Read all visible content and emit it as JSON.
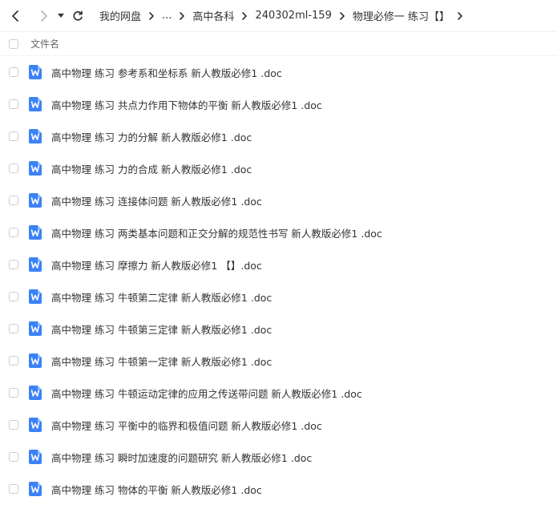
{
  "toolbar": {
    "back_icon": "back-arrow-icon",
    "forward_icon": "forward-arrow-icon",
    "history_icon": "dropdown-caret-icon",
    "refresh_icon": "refresh-icon"
  },
  "breadcrumb": {
    "items": [
      "我的网盘",
      "...",
      "高中各科",
      "240302ml-159",
      "物理必修一 练习【】"
    ]
  },
  "list_header": {
    "column_name": "文件名"
  },
  "colors": {
    "doc_icon": "#3b82f6",
    "text": "#333333"
  },
  "files": [
    {
      "name": "高中物理 练习 参考系和坐标系 新人教版必修1 .doc"
    },
    {
      "name": "高中物理 练习 共点力作用下物体的平衡 新人教版必修1 .doc"
    },
    {
      "name": "高中物理 练习 力的分解 新人教版必修1 .doc"
    },
    {
      "name": "高中物理 练习 力的合成 新人教版必修1 .doc"
    },
    {
      "name": "高中物理 练习 连接体问题 新人教版必修1 .doc"
    },
    {
      "name": "高中物理 练习 两类基本问题和正交分解的规范性书写 新人教版必修1 .doc"
    },
    {
      "name": "高中物理 练习 摩擦力 新人教版必修1 【】.doc"
    },
    {
      "name": "高中物理 练习 牛顿第二定律 新人教版必修1 .doc"
    },
    {
      "name": "高中物理 练习 牛顿第三定律 新人教版必修1 .doc"
    },
    {
      "name": "高中物理 练习 牛顿第一定律 新人教版必修1 .doc"
    },
    {
      "name": "高中物理 练习 牛顿运动定律的应用之传送带问题 新人教版必修1 .doc"
    },
    {
      "name": "高中物理 练习 平衡中的临界和极值问题 新人教版必修1 .doc"
    },
    {
      "name": "高中物理 练习 瞬时加速度的问题研究 新人教版必修1 .doc"
    },
    {
      "name": "高中物理 练习 物体的平衡 新人教版必修1 .doc"
    }
  ]
}
